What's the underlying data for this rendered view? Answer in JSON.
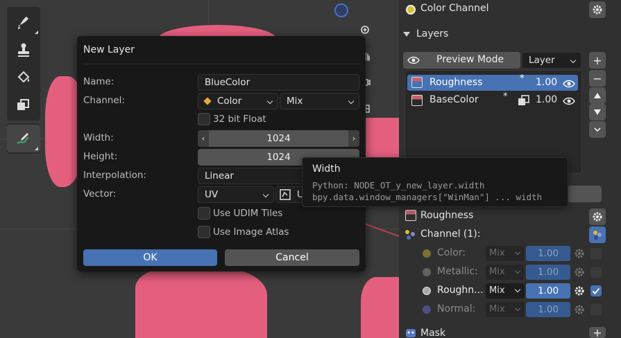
{
  "dialog": {
    "title": "New Layer",
    "name_label": "Name:",
    "name_value": "BlueColor",
    "channel_label": "Channel:",
    "channel_value": "Color",
    "blend_value": "Mix",
    "float_label": "32 bit Float",
    "width_label": "Width:",
    "width_value": "1024",
    "height_label": "Height:",
    "height_value": "1024",
    "interp_label": "Interpolation:",
    "interp_value": "Linear",
    "vector_label": "Vector:",
    "vector_value": "UV",
    "vector_extra": "U",
    "udim_label": "Use UDIM Tiles",
    "atlas_label": "Use Image Atlas",
    "ok_label": "OK",
    "cancel_label": "Cancel"
  },
  "tooltip": {
    "title": "Width",
    "line1": "Python: NODE_OT_y_new_layer.width",
    "line2": "bpy.data.window_managers[\"WinMan\"] ... width"
  },
  "panel": {
    "color_channel": "Color Channel",
    "layers_header": "Layers",
    "preview_mode": "Preview Mode",
    "layer_dropdown": "Layer",
    "layers": [
      {
        "name": "Roughness",
        "value": "1.00"
      },
      {
        "name": "BaseColor",
        "value": "1.00"
      }
    ],
    "active_layer": "Roughness",
    "channel_header": "Channel (1):",
    "channels": [
      {
        "label": "Color:",
        "blend": "Mix",
        "value": "1.00"
      },
      {
        "label": "Metallic:",
        "blend": "Mix",
        "value": "1.00"
      },
      {
        "label": "Roughn...",
        "blend": "Mix",
        "value": "1.00"
      },
      {
        "label": "Normal:",
        "blend": "Mix",
        "value": "1.00"
      }
    ],
    "mask_label": "Mask"
  },
  "colors": {
    "accent": "#4772b3",
    "mesh": "#e45f7e"
  }
}
